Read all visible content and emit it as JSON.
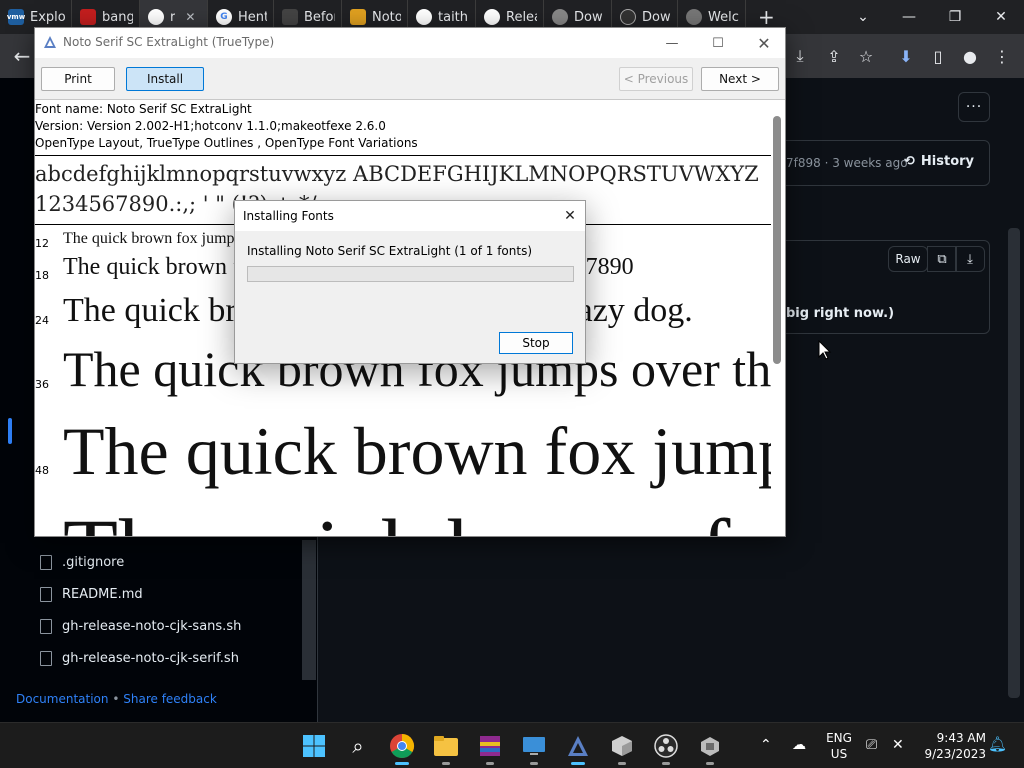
{
  "browser": {
    "tabs": [
      {
        "title": "Explo",
        "favicon_color": "#1f5fa0",
        "favicon_text": "vmw"
      },
      {
        "title": "bang",
        "favicon_color": "#c41e1e",
        "favicon_text": ""
      },
      {
        "title": "r",
        "favicon_color": "#ffffff",
        "favicon_text": "",
        "closable": true
      },
      {
        "title": "Hent",
        "favicon_color": "#4285f4",
        "favicon_text": "G"
      },
      {
        "title": "Befor",
        "favicon_color": "#222",
        "favicon_text": ""
      },
      {
        "title": "Noto",
        "favicon_color": "#e0a020",
        "favicon_text": ""
      },
      {
        "title": "taith",
        "favicon_color": "#ffffff",
        "favicon_text": ""
      },
      {
        "title": "Relea",
        "favicon_color": "#ffffff",
        "favicon_text": ""
      },
      {
        "title": "Dow",
        "favicon_color": "#888",
        "favicon_text": ""
      },
      {
        "title": "Dow",
        "favicon_color": "#333",
        "favicon_text": ""
      },
      {
        "title": "Welc",
        "favicon_color": "#777",
        "favicon_text": ""
      }
    ],
    "new_tab": "+"
  },
  "github": {
    "files": [
      ".gitignore",
      "README.md",
      "gh-release-noto-cjk-sans.sh",
      "gh-release-noto-cjk-serif.sh"
    ],
    "footer_doc": "Documentation",
    "footer_sep": "•",
    "footer_feedback": "Share feedback",
    "commit_meta": "7f898 · 3 weeks ago",
    "history": "History",
    "raw": "Raw",
    "partial_text": "big right now.)"
  },
  "fontviewer": {
    "title": "Noto Serif SC ExtraLight (TrueType)",
    "print": "Print",
    "install": "Install",
    "previous": "< Previous",
    "next": "Next >",
    "font_name": "Font name: Noto Serif SC ExtraLight",
    "version": "Version: Version 2.002-H1;hotconv 1.1.0;makeotfexe 2.6.0",
    "features": "OpenType Layout, TrueType Outlines , OpenType Font Variations",
    "alphabet": "abcdefghijklmnopqrstuvwxyz ABCDEFGHIJKLMNOPQRSTUVWXYZ",
    "digits": "1234567890.:,; ' \" (!?) +-*/=",
    "samples": [
      {
        "size": "12",
        "text": "The quick brown fox jumps over the lazy dog. 1234567890"
      },
      {
        "size": "18",
        "text": "The quick brown fox jumps over the lazy dog. 1234567890"
      },
      {
        "size": "24",
        "text": "The quick brown fox jumps over the lazy dog."
      },
      {
        "size": "36",
        "text": "The quick brown fox jumps over the lazy dog."
      },
      {
        "size": "48",
        "text": "The quick brown fox jumps over the lazy dog."
      },
      {
        "size": "",
        "text": "The quick brown fox"
      }
    ]
  },
  "dialog": {
    "title": "Installing Fonts",
    "message": "Installing Noto Serif SC ExtraLight (1 of 1 fonts)",
    "progress": 0,
    "stop": "Stop"
  },
  "taskbar": {
    "lang_1": "ENG",
    "lang_2": "US",
    "time": "9:43 AM",
    "date": "9/23/2023"
  }
}
